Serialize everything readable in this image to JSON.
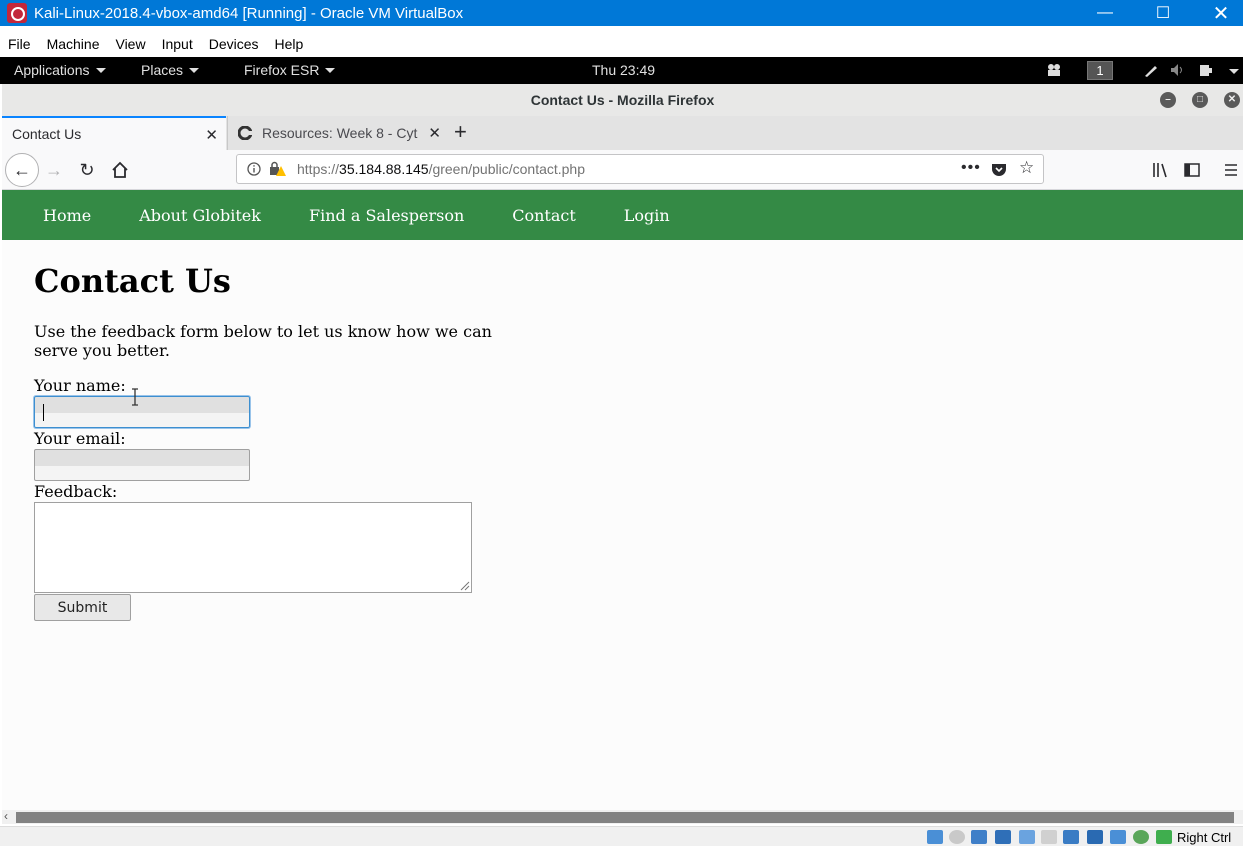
{
  "vbox": {
    "title": "Kali-Linux-2018.4-vbox-amd64 [Running] - Oracle VM VirtualBox",
    "menu": [
      "File",
      "Machine",
      "View",
      "Input",
      "Devices",
      "Help"
    ],
    "host_key": "Right Ctrl"
  },
  "kali_panel": {
    "applications": "Applications",
    "places": "Places",
    "firefox": "Firefox ESR",
    "clock": "Thu 23:49",
    "workspace": "1"
  },
  "firefox": {
    "window_title": "Contact Us - Mozilla Firefox",
    "tabs": [
      {
        "label": "Contact Us"
      },
      {
        "label": "Resources: Week 8 - Cyt"
      }
    ],
    "url": {
      "protocol": "https://",
      "host": "35.184.88.145",
      "path": "/green/public/contact.php"
    }
  },
  "site": {
    "nav": [
      "Home",
      "About Globitek",
      "Find a Salesperson",
      "Contact",
      "Login"
    ],
    "heading": "Contact Us",
    "intro": "Use the feedback form below to let us know how we can serve you better.",
    "form": {
      "name_label": "Your name:",
      "email_label": "Your email:",
      "feedback_label": "Feedback:",
      "submit_label": "Submit"
    }
  },
  "colors": {
    "site_nav": "#348a45",
    "vbox_titlebar": "#0078d7",
    "active_tab_accent": "#0a84ff"
  }
}
